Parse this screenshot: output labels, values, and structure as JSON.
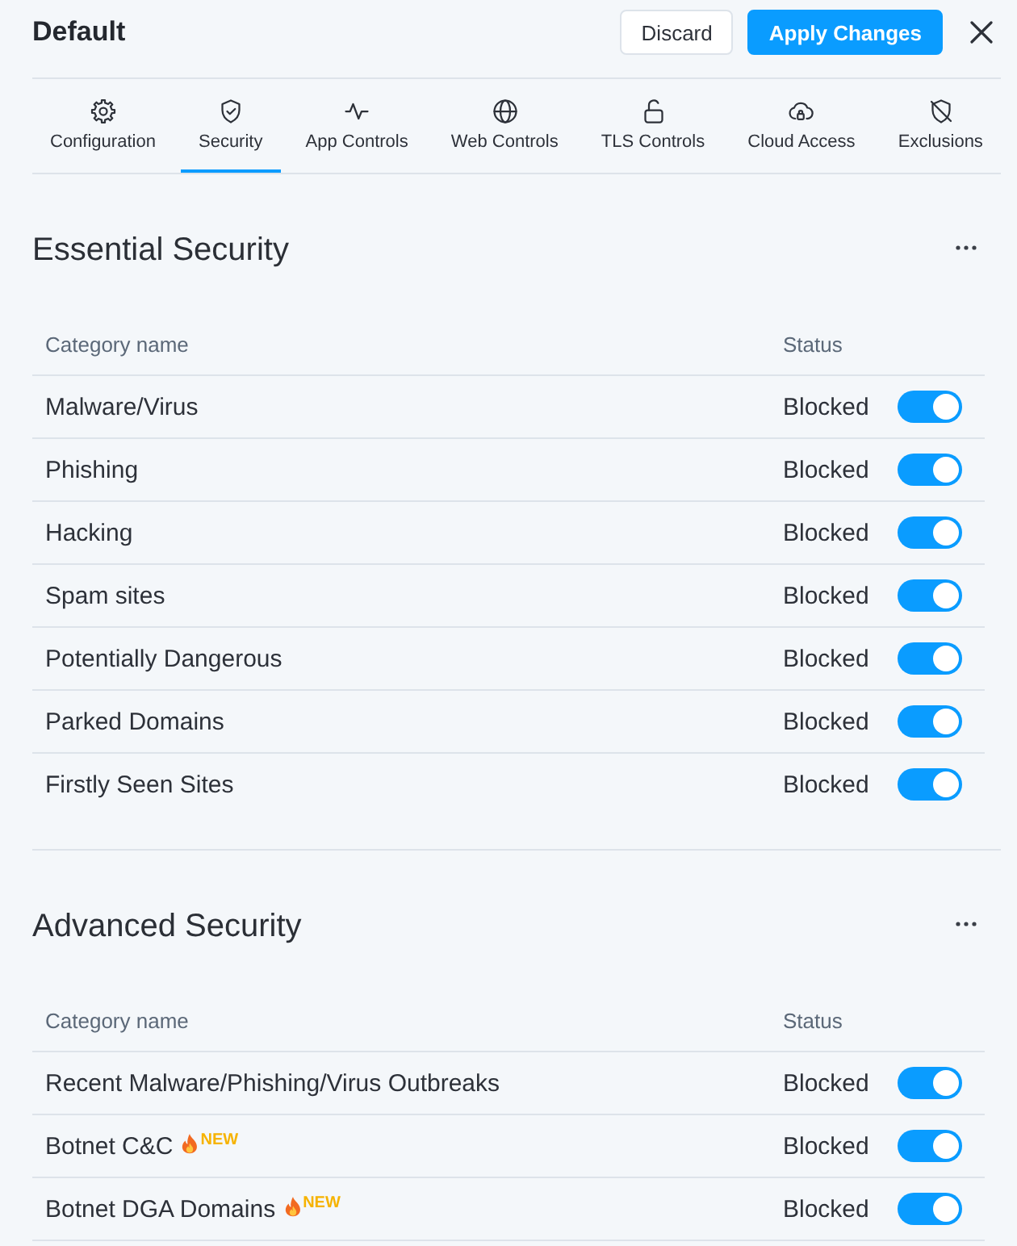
{
  "header": {
    "title": "Default",
    "buttons": [
      {
        "label": "Discard",
        "kind": "secondary"
      },
      {
        "label": "Apply Changes",
        "kind": "primary"
      }
    ]
  },
  "tabs": [
    {
      "label": "Configuration",
      "selected": false
    },
    {
      "label": "Security",
      "selected": true
    },
    {
      "label": "App Controls",
      "selected": false
    },
    {
      "label": "Web Controls",
      "selected": false
    },
    {
      "label": "TLS Controls",
      "selected": false
    },
    {
      "label": "Cloud Access",
      "selected": false
    },
    {
      "label": "Exclusions",
      "selected": false
    }
  ],
  "sections": [
    {
      "title": "Essential Security",
      "columns": [
        "Category name",
        "Status"
      ],
      "rows": [
        {
          "name": "Malware/Virus",
          "status": "Blocked",
          "on": true
        },
        {
          "name": "Phishing",
          "status": "Blocked",
          "on": true
        },
        {
          "name": "Hacking",
          "status": "Blocked",
          "on": true
        },
        {
          "name": "Spam sites",
          "status": "Blocked",
          "on": true
        },
        {
          "name": "Potentially Dangerous",
          "status": "Blocked",
          "on": true
        },
        {
          "name": "Parked Domains",
          "status": "Blocked",
          "on": true
        },
        {
          "name": "Firstly Seen Sites",
          "status": "Blocked",
          "on": true
        }
      ]
    },
    {
      "title": "Advanced Security",
      "columns": [
        "Category name",
        "Status"
      ],
      "rows": [
        {
          "name": "Recent Malware/Phishing/Virus Outbreaks",
          "status": "Blocked",
          "on": true
        },
        {
          "name": "Botnet C&C",
          "badge": "NEW",
          "status": "Blocked",
          "on": true
        },
        {
          "name": "Botnet DGA Domains",
          "badge": "NEW",
          "status": "Blocked",
          "on": true
        }
      ]
    }
  ]
}
